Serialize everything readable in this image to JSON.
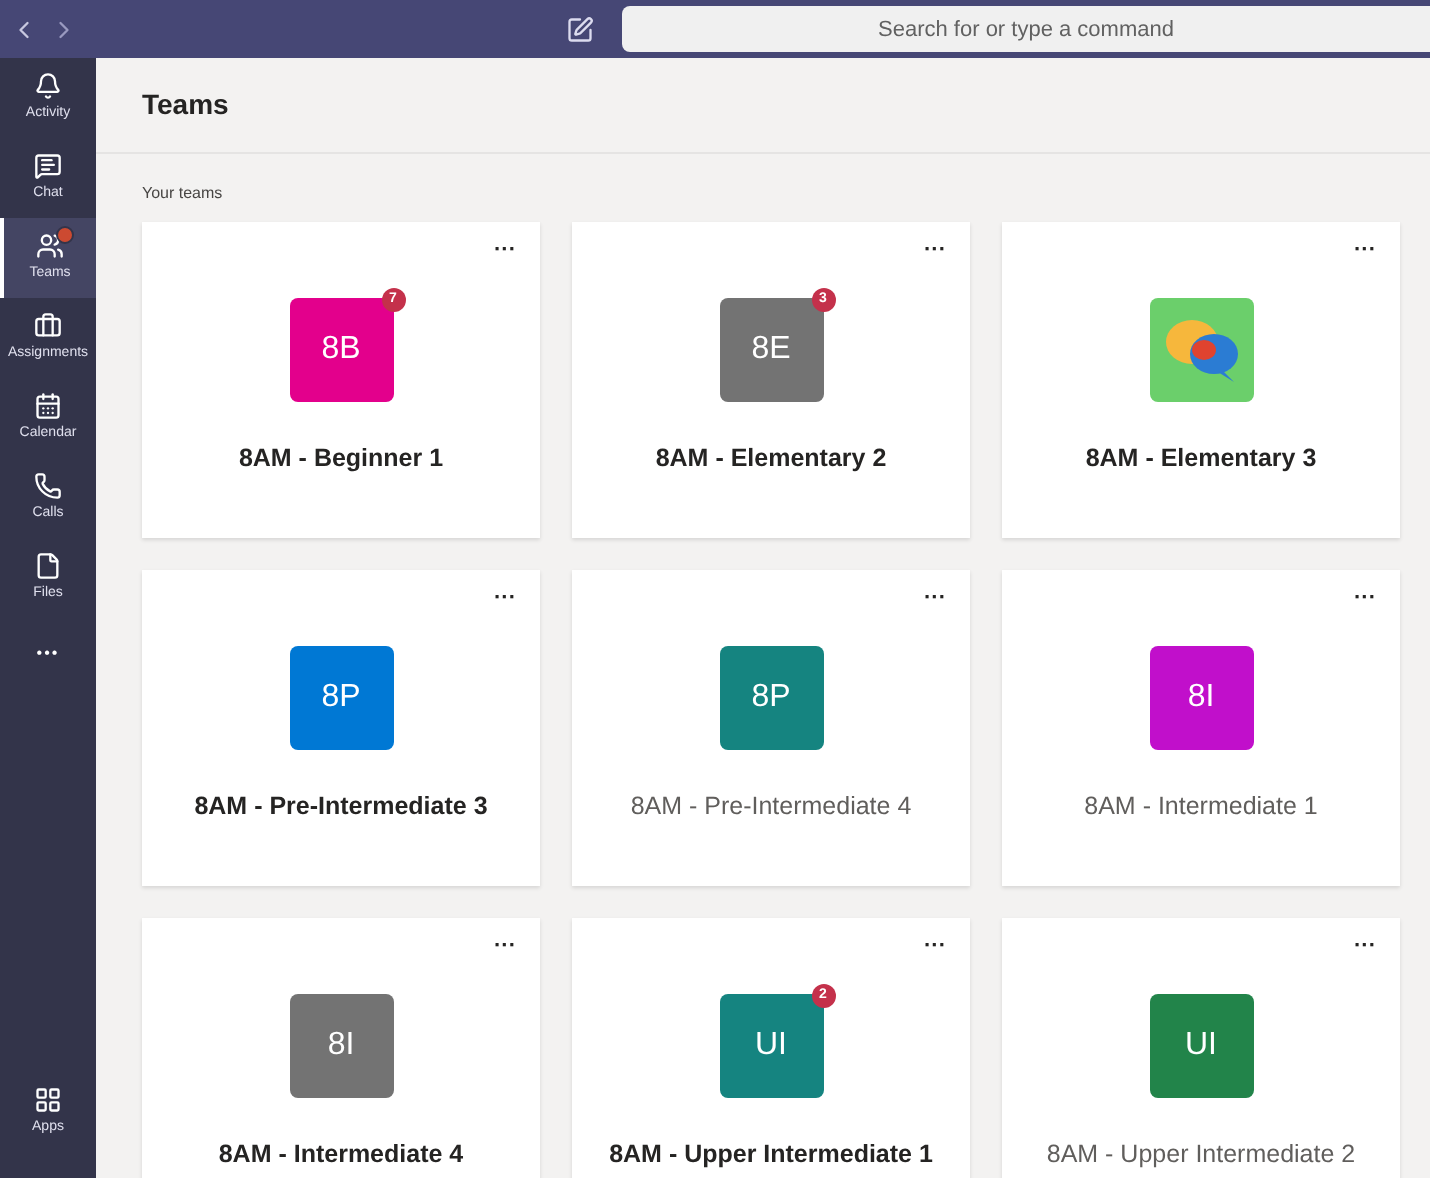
{
  "search": {
    "placeholder": "Search for or type a command"
  },
  "sidebar": {
    "items": [
      {
        "label": "Activity",
        "kind": "bell",
        "selected": false,
        "badge": false
      },
      {
        "label": "Chat",
        "kind": "chat",
        "selected": false,
        "badge": false
      },
      {
        "label": "Teams",
        "kind": "teams",
        "selected": true,
        "badge": true
      },
      {
        "label": "Assignments",
        "kind": "bag",
        "selected": false,
        "badge": false
      },
      {
        "label": "Calendar",
        "kind": "calendar",
        "selected": false,
        "badge": false
      },
      {
        "label": "Calls",
        "kind": "phone",
        "selected": false,
        "badge": false
      },
      {
        "label": "Files",
        "kind": "file",
        "selected": false,
        "badge": false
      }
    ],
    "more": "•••",
    "apps": {
      "label": "Apps"
    }
  },
  "page": {
    "title": "Teams",
    "section": "Your teams"
  },
  "teams": [
    {
      "name": "8AM - Beginner 1",
      "kind": "initials",
      "initials": "8B",
      "color": "#e3008c",
      "badge": "7",
      "unread": true,
      "more": "···"
    },
    {
      "name": "8AM - Elementary 2",
      "kind": "initials",
      "initials": "8E",
      "color": "#737373",
      "badge": "3",
      "unread": true,
      "more": "···"
    },
    {
      "name": "8AM - Elementary 3",
      "kind": "picture",
      "color": "#6bcf6b",
      "unread": true,
      "more": "···"
    },
    {
      "name": "8AM - Pre-Intermediate 3",
      "kind": "initials",
      "initials": "8P",
      "color": "#0078d4",
      "unread": true,
      "more": "···"
    },
    {
      "name": "8AM - Pre-Intermediate 4",
      "kind": "initials",
      "initials": "8P",
      "color": "#158480",
      "unread": false,
      "more": "···"
    },
    {
      "name": "8AM - Intermediate 1",
      "kind": "initials",
      "initials": "8I",
      "color": "#c10fcb",
      "unread": false,
      "more": "···"
    },
    {
      "name": "8AM - Intermediate 4",
      "kind": "initials",
      "initials": "8I",
      "color": "#737373",
      "unread": true,
      "more": "···"
    },
    {
      "name": "8AM - Upper Intermediate 1",
      "kind": "initials",
      "initials": "UI",
      "color": "#158480",
      "badge": "2",
      "unread": true,
      "more": "···"
    },
    {
      "name": "8AM - Upper Intermediate 2",
      "kind": "initials",
      "initials": "UI",
      "color": "#22844a",
      "unread": false,
      "more": "···"
    }
  ]
}
